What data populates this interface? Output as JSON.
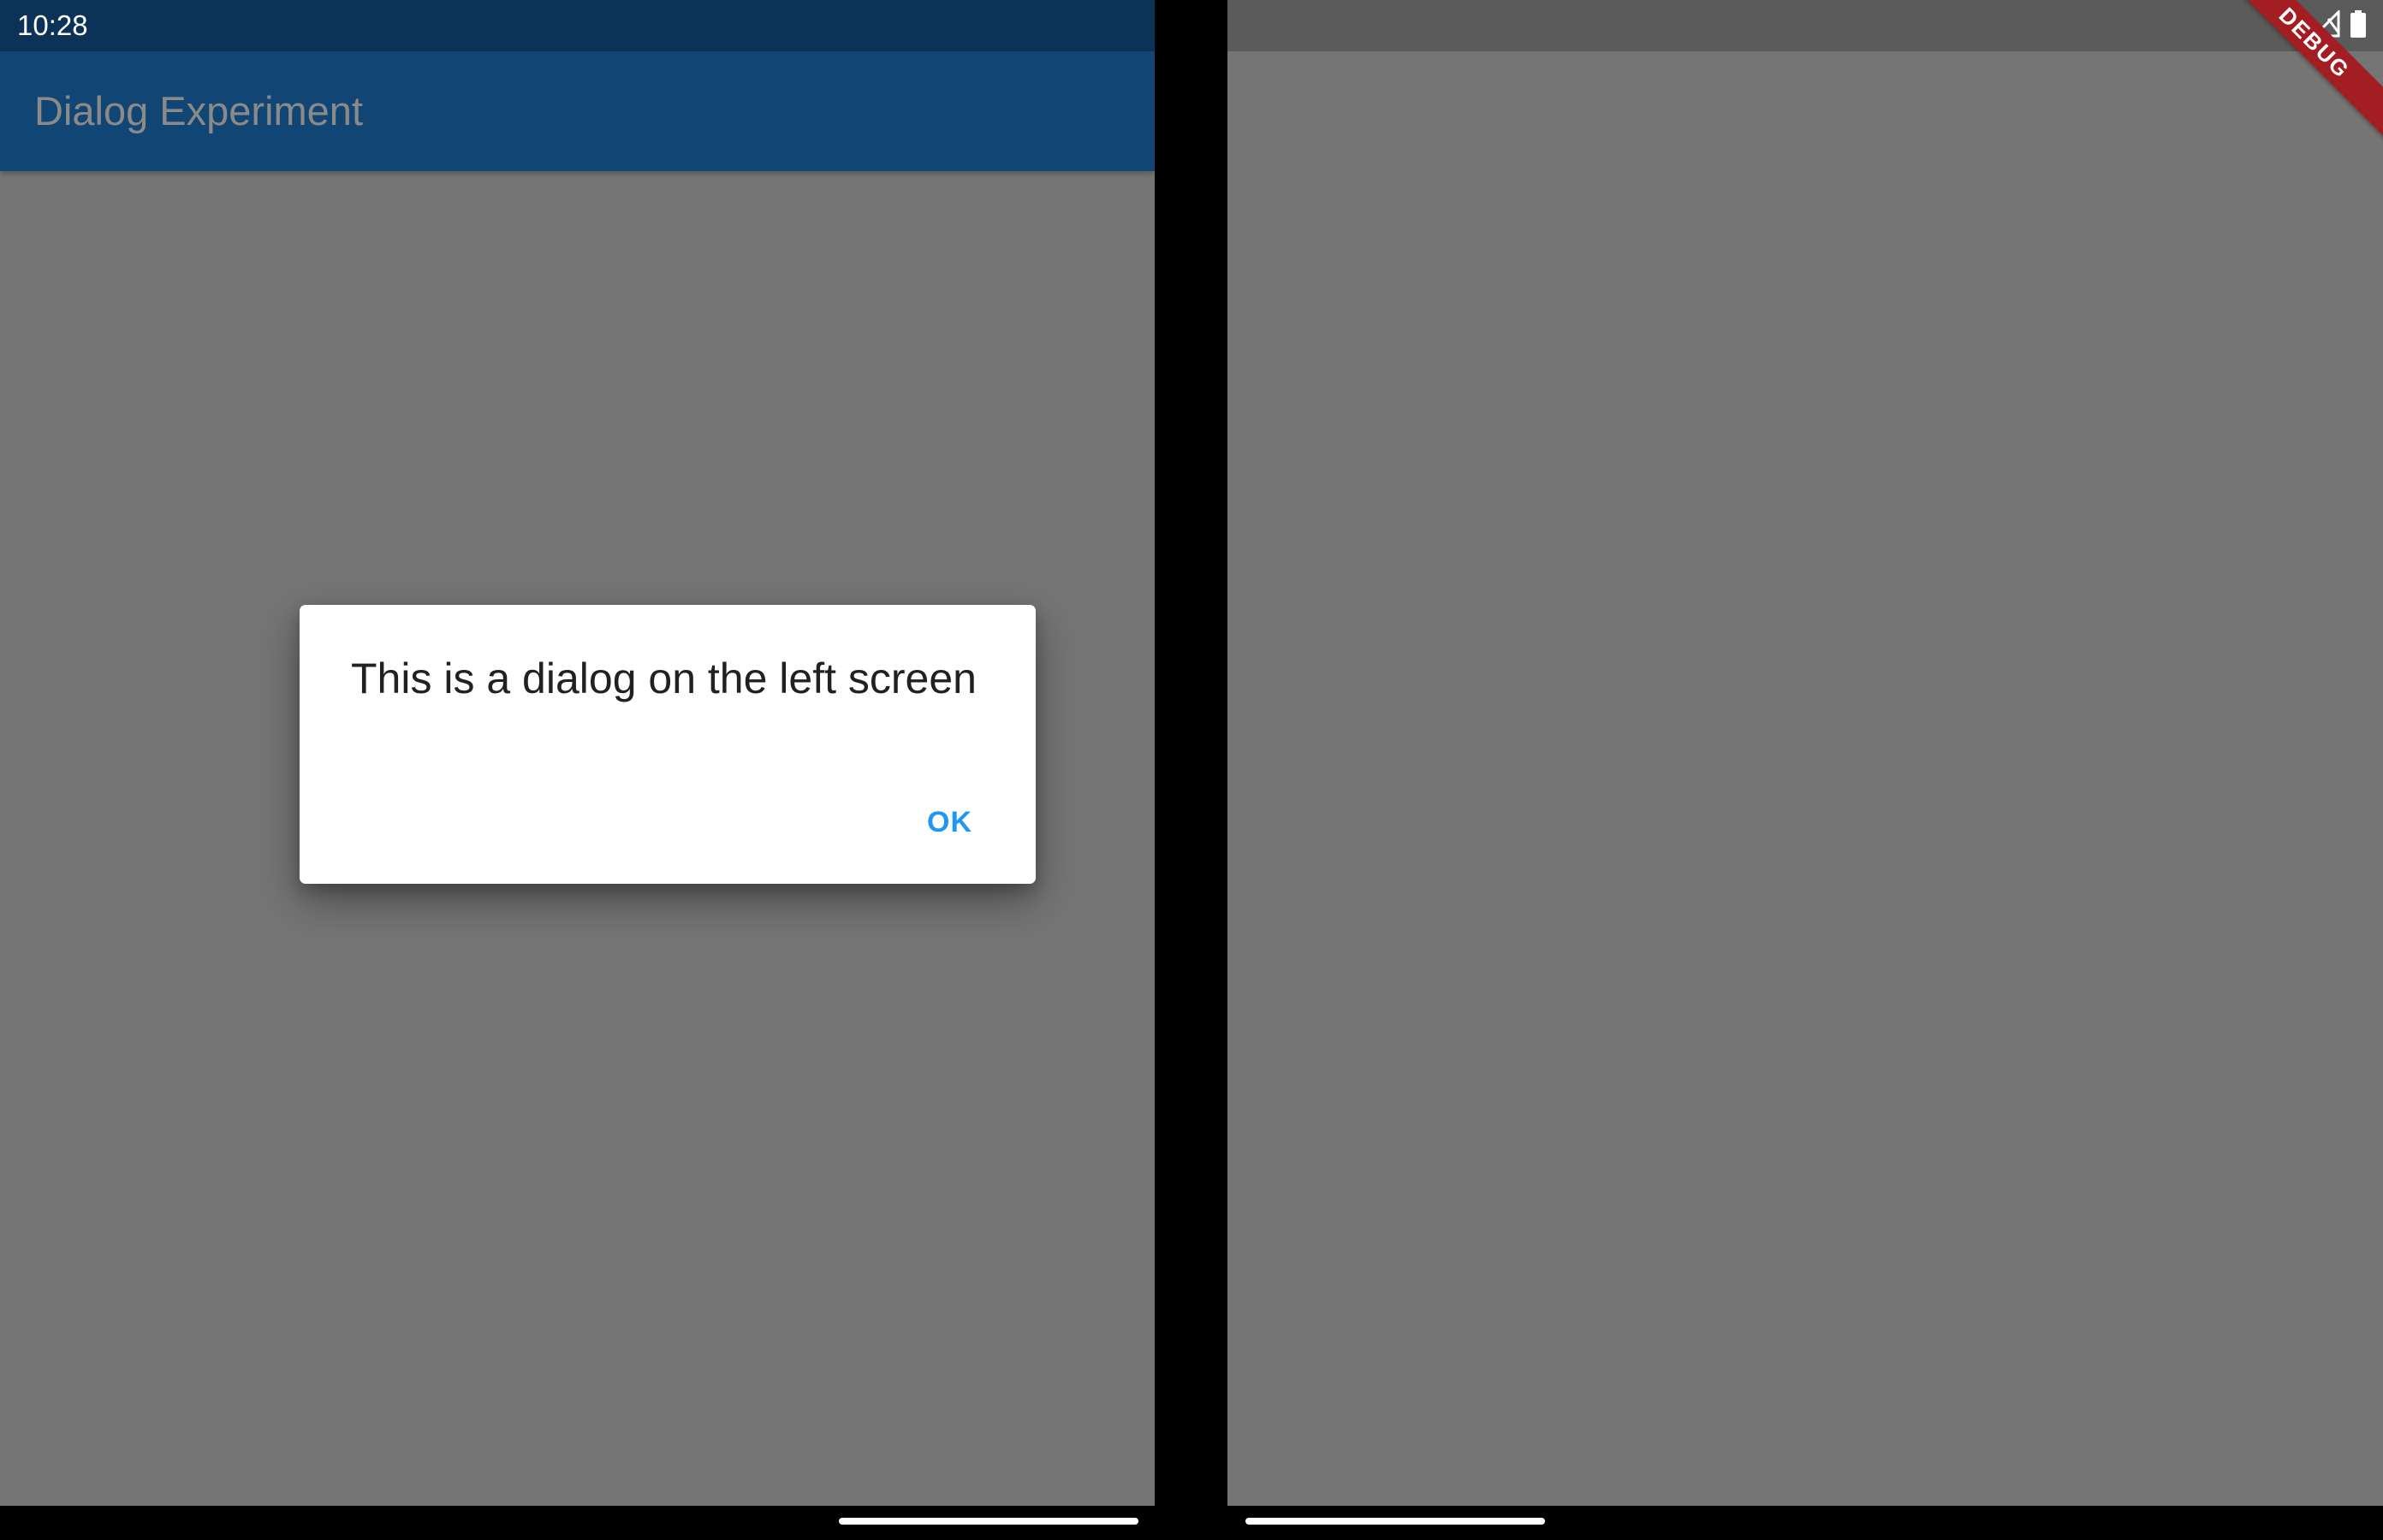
{
  "status_bar": {
    "time": "10:28",
    "icons": [
      "wifi-icon",
      "signal-icon",
      "battery-icon"
    ]
  },
  "app_bar": {
    "title": "Dialog Experiment"
  },
  "dialog": {
    "title": "This is a dialog on the left screen",
    "ok_label": "OK"
  },
  "debug_banner": {
    "label": "DEBUG"
  },
  "colors": {
    "status_bar_left": "#0c3357",
    "app_bar": "#114573",
    "scrim": "#757575",
    "dialog_button": "#2196f3",
    "debug_banner": "#a31e22"
  }
}
